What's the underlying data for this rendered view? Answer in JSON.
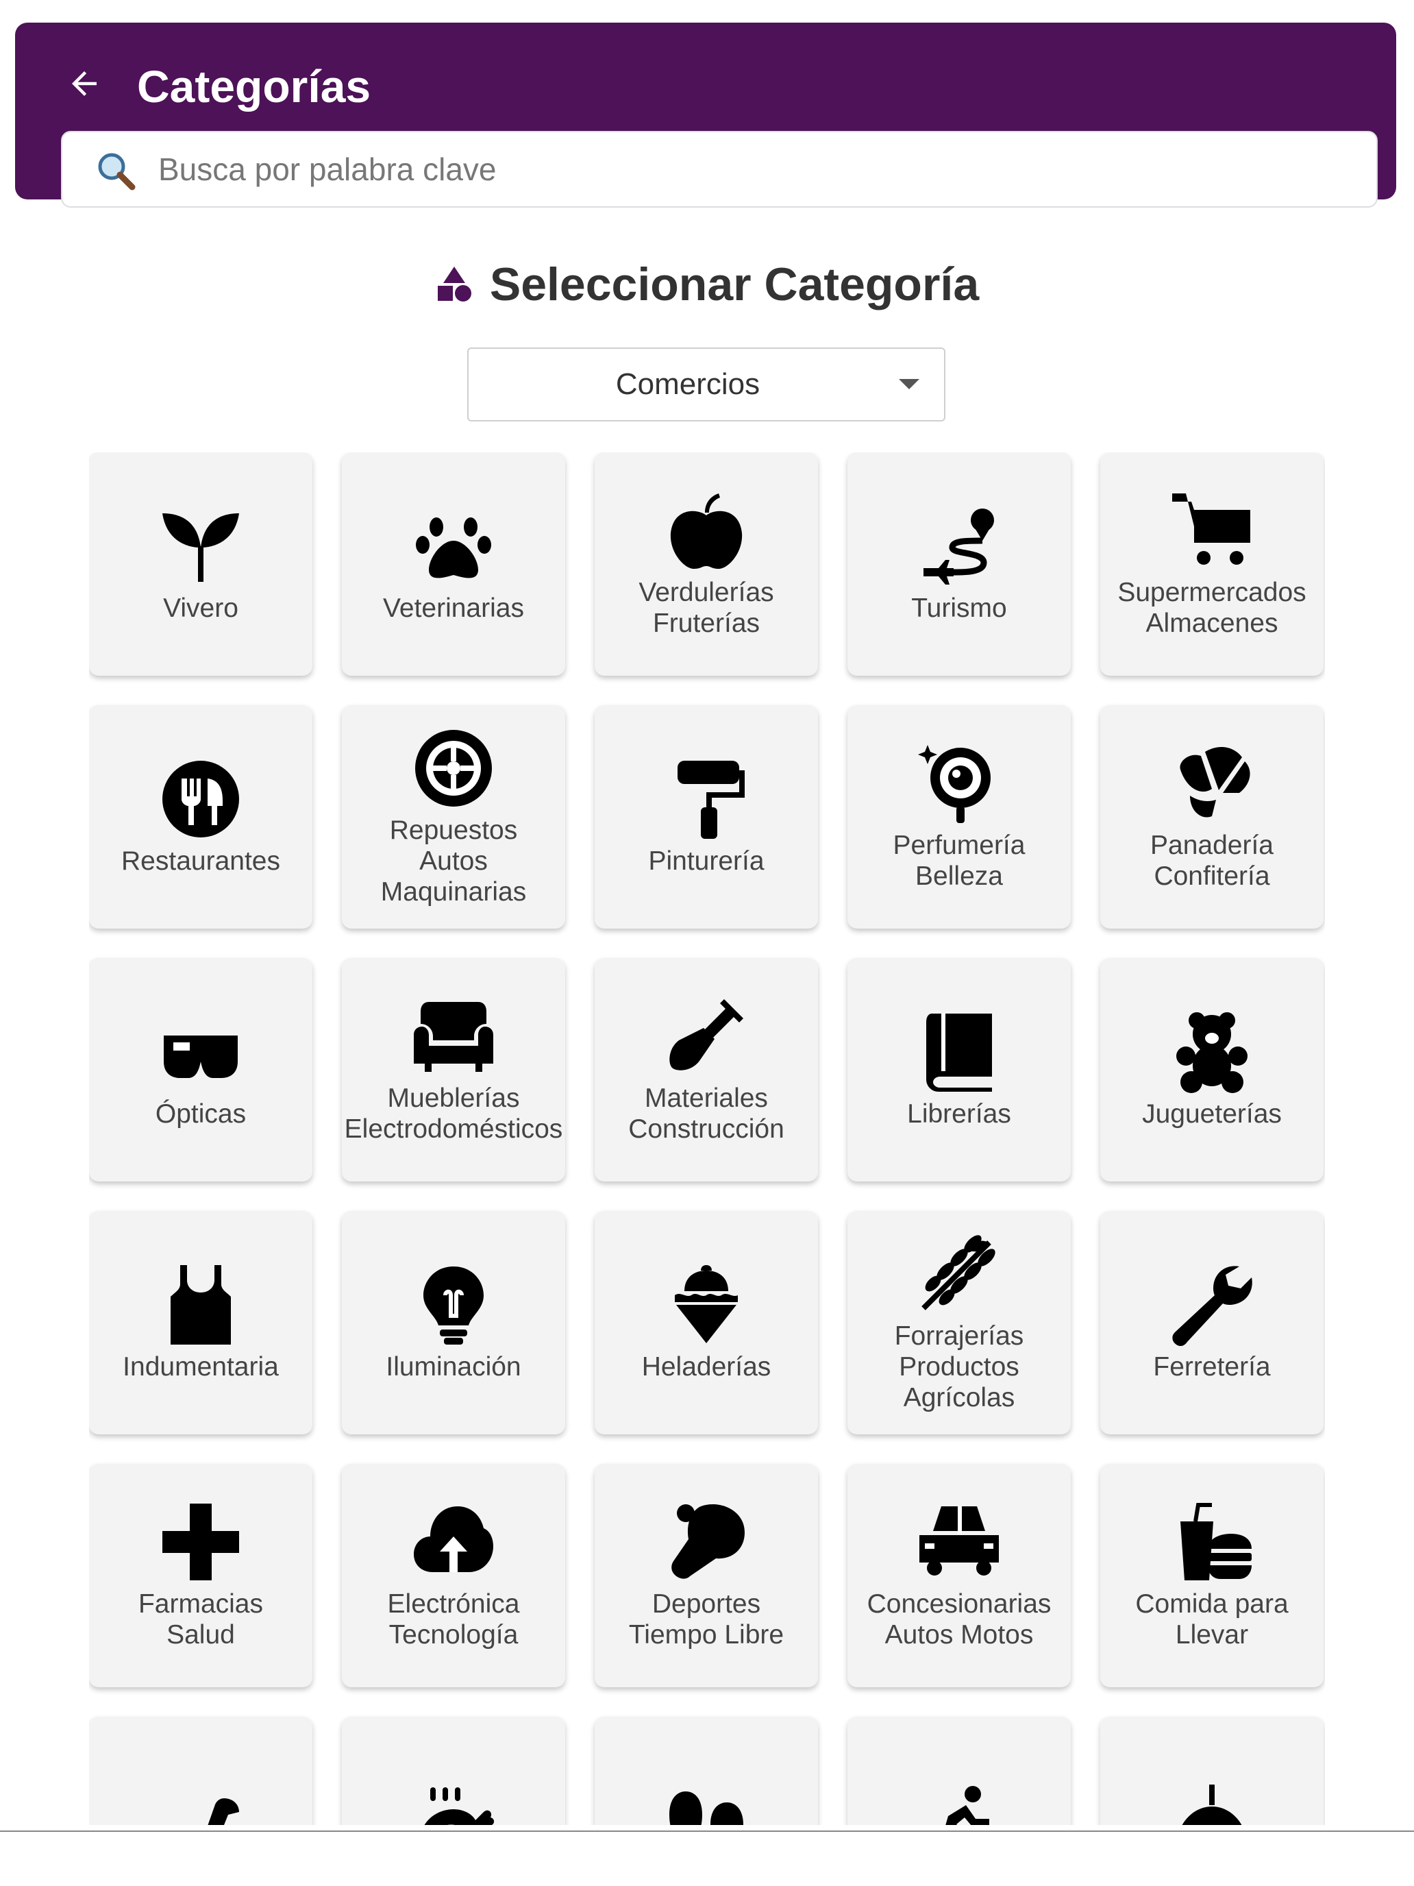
{
  "header": {
    "title": "Categorías",
    "back_icon": "arrow-left-icon",
    "background": "#4d1257"
  },
  "search": {
    "placeholder": "Busca por palabra clave",
    "value": "",
    "icon": "search-icon"
  },
  "section": {
    "title": "Seleccionar Categoría",
    "icon": "shapes-icon"
  },
  "category_select": {
    "selected": "Comercios"
  },
  "categories": [
    {
      "label": "Vivero",
      "icon": "seedling-icon"
    },
    {
      "label": "Veterinarias",
      "icon": "paw-icon"
    },
    {
      "label": "Verdulerías\nFruterías",
      "icon": "apple-icon"
    },
    {
      "label": "Turismo",
      "icon": "route-plane-icon"
    },
    {
      "label": "Supermercados\nAlmacenes",
      "icon": "cart-icon"
    },
    {
      "label": "Restaurantes",
      "icon": "utensils-icon"
    },
    {
      "label": "Repuestos\nAutos\nMaquinarias",
      "icon": "tire-icon"
    },
    {
      "label": "Pinturería",
      "icon": "paint-roller-icon"
    },
    {
      "label": "Perfumería\nBelleza",
      "icon": "mirror-icon"
    },
    {
      "label": "Panadería\nConfitería",
      "icon": "croissant-icon"
    },
    {
      "label": "Ópticas",
      "icon": "glasses-icon"
    },
    {
      "label": "Mueblerías\nElectrodomésticos",
      "icon": "couch-icon"
    },
    {
      "label": "Materiales\nConstrucción",
      "icon": "shovel-icon"
    },
    {
      "label": "Librerías",
      "icon": "book-icon"
    },
    {
      "label": "Jugueterías",
      "icon": "teddy-bear-icon"
    },
    {
      "label": "Indumentaria",
      "icon": "shirt-icon"
    },
    {
      "label": "Iluminación",
      "icon": "lightbulb-icon"
    },
    {
      "label": "Heladerías",
      "icon": "ice-cream-icon"
    },
    {
      "label": "Forrajerías\nProductos\nAgrícolas",
      "icon": "wheat-icon"
    },
    {
      "label": "Ferretería",
      "icon": "wrench-icon"
    },
    {
      "label": "Farmacias\nSalud",
      "icon": "plus-icon"
    },
    {
      "label": "Electrónica\nTecnología",
      "icon": "cloud-upload-icon"
    },
    {
      "label": "Deportes\nTiempo Libre",
      "icon": "ping-pong-icon"
    },
    {
      "label": "Concesionarias\nAutos Motos",
      "icon": "car-icon"
    },
    {
      "label": "Comida para\nLlevar",
      "icon": "burger-soda-icon"
    },
    {
      "label": "",
      "icon": "dinosaur-icon"
    },
    {
      "label": "",
      "icon": "drumstick-icon"
    },
    {
      "label": "",
      "icon": "shoe-prints-icon"
    },
    {
      "label": "",
      "icon": "cyclist-icon"
    },
    {
      "label": "",
      "icon": "ceiling-lamp-icon"
    }
  ]
}
